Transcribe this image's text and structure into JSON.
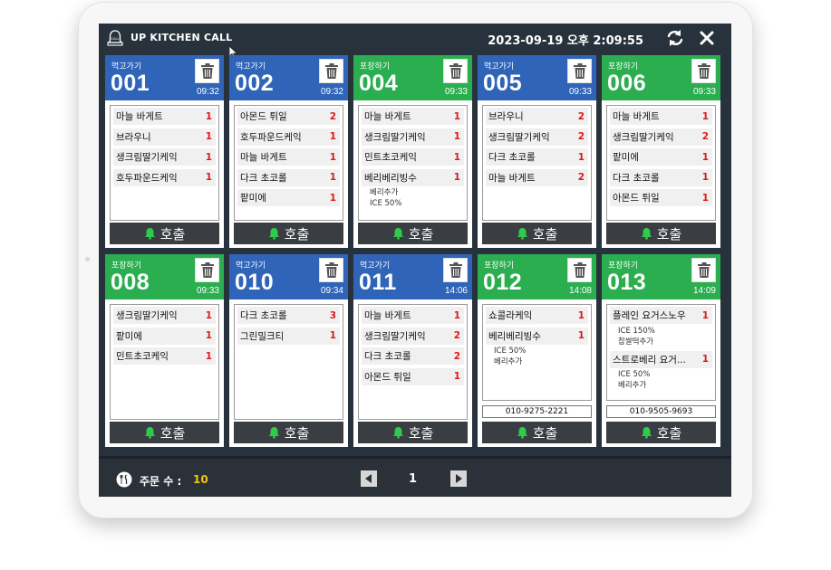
{
  "app": {
    "title": "UP KITCHEN CALL",
    "bell_label": "CALL",
    "datetime": "2023-09-19 오후 2:09:55"
  },
  "colors": {
    "eat_in": "#2f64b9",
    "takeout": "#2aae4f",
    "quantity": "#e01818",
    "order_count": "#f0c419"
  },
  "call_label": "호출",
  "orders": [
    {
      "type": "먹고가기",
      "kind": "eat",
      "number": "001",
      "time": "09:32",
      "items": [
        {
          "name": "마늘 바게트",
          "qty": "1",
          "options": []
        },
        {
          "name": "브라우니",
          "qty": "1",
          "options": []
        },
        {
          "name": "생크림딸기케익",
          "qty": "1",
          "options": []
        },
        {
          "name": "호두파운드케익",
          "qty": "1",
          "options": []
        }
      ],
      "phone": ""
    },
    {
      "type": "먹고가기",
      "kind": "eat",
      "number": "002",
      "time": "09:32",
      "items": [
        {
          "name": "아몬드 튀일",
          "qty": "2",
          "options": []
        },
        {
          "name": "호두파운드케익",
          "qty": "1",
          "options": []
        },
        {
          "name": "마늘 바게트",
          "qty": "1",
          "options": []
        },
        {
          "name": "다크 초코롤",
          "qty": "1",
          "options": []
        },
        {
          "name": "팥미에",
          "qty": "1",
          "options": []
        }
      ],
      "phone": ""
    },
    {
      "type": "포장하기",
      "kind": "pack",
      "number": "004",
      "time": "09:33",
      "items": [
        {
          "name": "마늘 바게트",
          "qty": "1",
          "options": []
        },
        {
          "name": "생크림딸기케익",
          "qty": "1",
          "options": []
        },
        {
          "name": "민트초코케익",
          "qty": "1",
          "options": []
        },
        {
          "name": "베리베리빙수",
          "qty": "1",
          "options": [
            "베리추가",
            "ICE 50%"
          ]
        }
      ],
      "phone": ""
    },
    {
      "type": "먹고가기",
      "kind": "eat",
      "number": "005",
      "time": "09:33",
      "items": [
        {
          "name": "브라우니",
          "qty": "2",
          "options": []
        },
        {
          "name": "생크림딸기케익",
          "qty": "2",
          "options": []
        },
        {
          "name": "다크 초코롤",
          "qty": "1",
          "options": []
        },
        {
          "name": "마늘 바게트",
          "qty": "2",
          "options": []
        }
      ],
      "phone": ""
    },
    {
      "type": "포장하기",
      "kind": "pack",
      "number": "006",
      "time": "09:33",
      "items": [
        {
          "name": "마늘 바게트",
          "qty": "1",
          "options": []
        },
        {
          "name": "생크림딸기케익",
          "qty": "2",
          "options": []
        },
        {
          "name": "팥미에",
          "qty": "1",
          "options": []
        },
        {
          "name": "다크 초코롤",
          "qty": "1",
          "options": []
        },
        {
          "name": "아몬드 튀일",
          "qty": "1",
          "options": []
        }
      ],
      "phone": ""
    },
    {
      "type": "포장하기",
      "kind": "pack",
      "number": "008",
      "time": "09:33",
      "items": [
        {
          "name": "생크림딸기케익",
          "qty": "1",
          "options": []
        },
        {
          "name": "팥미에",
          "qty": "1",
          "options": []
        },
        {
          "name": "민트초코케익",
          "qty": "1",
          "options": []
        }
      ],
      "phone": ""
    },
    {
      "type": "먹고가기",
      "kind": "eat",
      "number": "010",
      "time": "09:34",
      "items": [
        {
          "name": "다크 초코롤",
          "qty": "3",
          "options": []
        },
        {
          "name": "그린밀크티",
          "qty": "1",
          "options": []
        }
      ],
      "phone": ""
    },
    {
      "type": "먹고가기",
      "kind": "eat",
      "number": "011",
      "time": "14:06",
      "items": [
        {
          "name": "마늘 바게트",
          "qty": "1",
          "options": []
        },
        {
          "name": "생크림딸기케익",
          "qty": "2",
          "options": []
        },
        {
          "name": "다크 초코롤",
          "qty": "2",
          "options": []
        },
        {
          "name": "아몬드 튀일",
          "qty": "1",
          "options": []
        }
      ],
      "phone": ""
    },
    {
      "type": "포장하기",
      "kind": "pack",
      "number": "012",
      "time": "14:08",
      "items": [
        {
          "name": "쇼콜라케익",
          "qty": "1",
          "options": []
        },
        {
          "name": "베리베리빙수",
          "qty": "1",
          "options": [
            "ICE 50%",
            "베리추가"
          ]
        }
      ],
      "phone": "010-9275-2221"
    },
    {
      "type": "포장하기",
      "kind": "pack",
      "number": "013",
      "time": "14:09",
      "items": [
        {
          "name": "플레인 요거스노우",
          "qty": "1",
          "options": [
            "ICE 150%",
            "찹쌀떡추가"
          ]
        },
        {
          "name": "스트로베리 요거...",
          "qty": "1",
          "options": [
            "ICE 50%",
            "베리추가"
          ]
        }
      ],
      "phone": "010-9505-9693"
    }
  ],
  "footer": {
    "order_count_label": "주문 수 :",
    "order_count": "10",
    "page": "1"
  }
}
